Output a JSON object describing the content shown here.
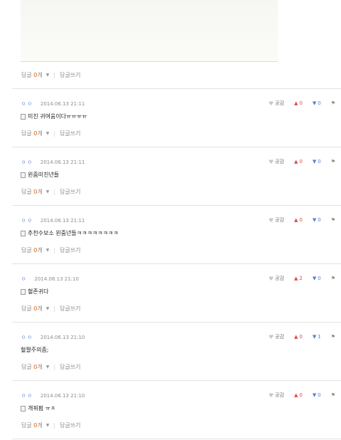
{
  "reply_prefix": "답글",
  "reply_count": "0",
  "reply_suffix": "개",
  "reply_write": "답글쓰기",
  "like_label": "공감",
  "comments": [
    {
      "dots": "ㅇㅇ",
      "time": "2014.06.13 21:11",
      "text": "미친 귀여움이다ㅠㅠㅠㅠ",
      "up": "0",
      "down": "0"
    },
    {
      "dots": "ㅇㅇ",
      "time": "2014.06.13 21:11",
      "text": "윈줌미친년들",
      "up": "0",
      "down": "0"
    },
    {
      "dots": "ㅇㅇ",
      "time": "2014.06.13 21:11",
      "text": "추천수보소 윈줌년들ㅋㅋㅋㅋㅋㅋㅋㅋ",
      "up": "0",
      "down": "0"
    },
    {
      "dots": "ㅇ",
      "time": "2014.06.13 21:10",
      "text": "혈존귀다",
      "up": "2",
      "down": "0"
    },
    {
      "dots": "ㅇㅇ",
      "time": "2014.06.13 21:10",
      "text": "혈짤주의좀;",
      "up": "0",
      "down": "1",
      "no_icon": true
    },
    {
      "dots": "ㅇㅇ",
      "time": "2014.06.13 21:10",
      "text": "개꿔펌 ㅠㅈ",
      "up": "0",
      "down": "0"
    }
  ]
}
